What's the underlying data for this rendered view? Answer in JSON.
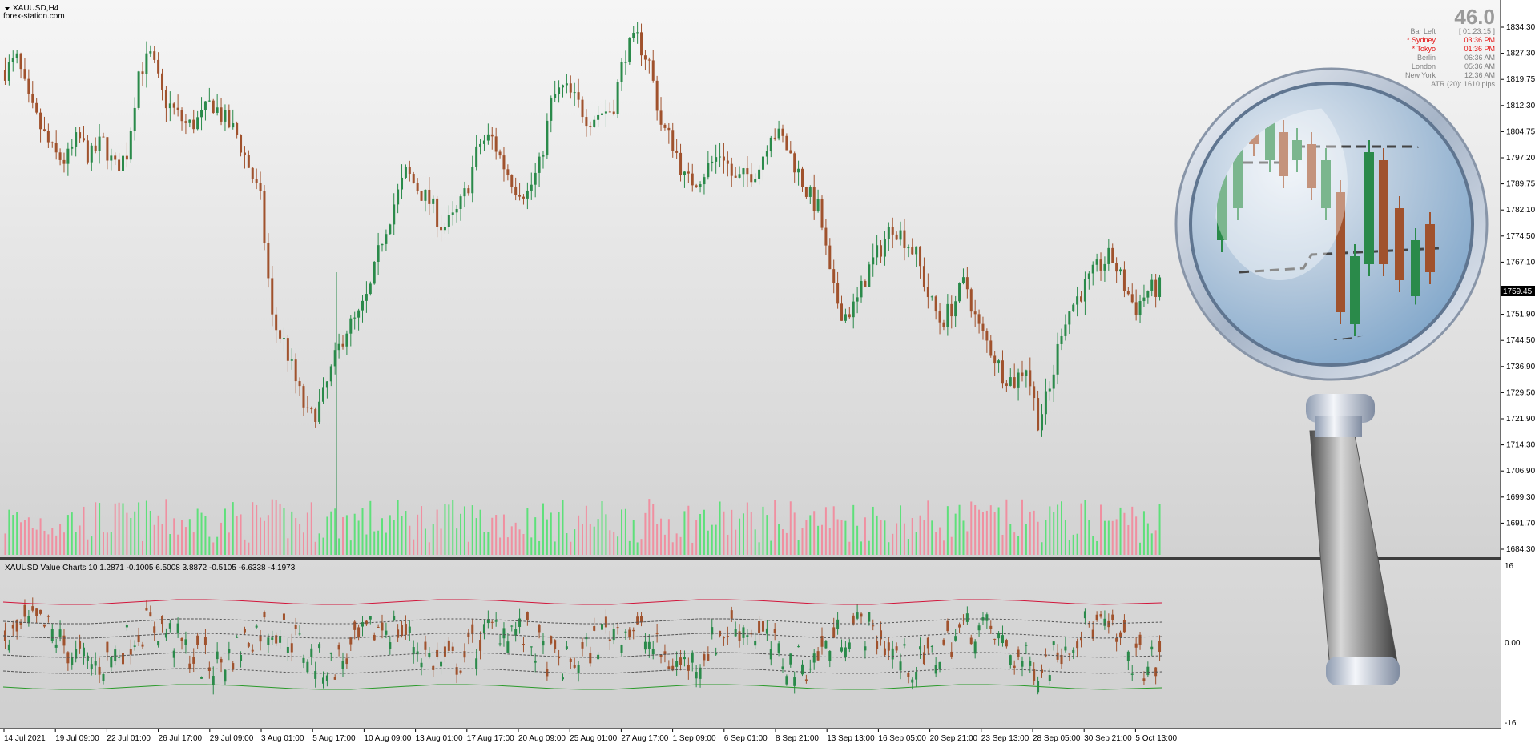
{
  "chart": {
    "symbol_title": "XAUUSD,H4",
    "watermark": "forex-station.com",
    "spread": "46.0",
    "current_price": "1759.45",
    "colors": {
      "bg_top": "#f4f4f4",
      "bg_bottom": "#d4d4d4",
      "bull": "#2a8a4a",
      "bear": "#a0522d",
      "vol_bull": "#5ee07a",
      "vol_bear": "#f08fa0",
      "upper": "#d2143a",
      "lower": "#2a9a2a"
    },
    "price_axis": [
      "1834.30",
      "1827.30",
      "1819.75",
      "1812.30",
      "1804.75",
      "1797.20",
      "1789.75",
      "1782.10",
      "1774.50",
      "1767.10",
      "1751.90",
      "1744.50",
      "1736.90",
      "1729.50",
      "1721.90",
      "1714.30",
      "1706.90",
      "1699.30",
      "1691.70",
      "1684.30"
    ],
    "time_axis": [
      "14 Jul 2021",
      "19 Jul 09:00",
      "22 Jul 01:00",
      "26 Jul 17:00",
      "29 Jul 09:00",
      "3 Aug 01:00",
      "5 Aug 17:00",
      "10 Aug 09:00",
      "13 Aug 01:00",
      "17 Aug 17:00",
      "20 Aug 09:00",
      "25 Aug 01:00",
      "27 Aug 17:00",
      "1 Sep 09:00",
      "6 Sep 01:00",
      "8 Sep 21:00",
      "13 Sep 13:00",
      "16 Sep 05:00",
      "20 Sep 21:00",
      "23 Sep 13:00",
      "28 Sep 05:00",
      "30 Sep 21:00",
      "5 Oct 13:00"
    ]
  },
  "info_panel": {
    "rows": [
      {
        "label": "Bar Left",
        "value": "[ 01:23:15 ]",
        "highlight": false
      },
      {
        "label": "* Sydney",
        "value": "03:36 PM",
        "highlight": true
      },
      {
        "label": "* Tokyo",
        "value": "01:36 PM",
        "highlight": true
      },
      {
        "label": "Berlin",
        "value": "06:36 AM",
        "highlight": false
      },
      {
        "label": "London",
        "value": "05:36 AM",
        "highlight": false
      },
      {
        "label": "New York",
        "value": "12:36 AM",
        "highlight": false
      }
    ],
    "atr": "ATR (20): 1610 pips"
  },
  "subwindow": {
    "title": "XAUUSD Value Charts 10 1.2871 -0.1005 6.5008 3.8872 -0.5105 -6.6338 -4.1973",
    "axis": [
      "16",
      "0.00",
      "-16"
    ]
  },
  "chart_data": {
    "type": "candlestick",
    "series_anchors": [
      1822,
      1825,
      1812,
      1805,
      1798,
      1796,
      1803,
      1797,
      1802,
      1794,
      1798,
      1822,
      1826,
      1814,
      1810,
      1806,
      1808,
      1813,
      1808,
      1804,
      1795,
      1785,
      1750,
      1744,
      1732,
      1722,
      1727,
      1738,
      1748,
      1751,
      1759,
      1774,
      1784,
      1793,
      1788,
      1784,
      1777,
      1780,
      1788,
      1801,
      1803,
      1795,
      1789,
      1787,
      1795,
      1814,
      1817,
      1813,
      1808,
      1810,
      1811,
      1827,
      1831,
      1824,
      1806,
      1801,
      1790,
      1791,
      1795,
      1799,
      1790,
      1792,
      1794,
      1805,
      1802,
      1795,
      1787,
      1782,
      1760,
      1752,
      1755,
      1765,
      1771,
      1778,
      1774,
      1769,
      1757,
      1750,
      1755,
      1762,
      1749,
      1743,
      1736,
      1733,
      1738,
      1722,
      1731,
      1750,
      1756,
      1761,
      1766,
      1769,
      1761,
      1754,
      1759,
      1760
    ],
    "bull_color": "#2a8a4a",
    "bear_color": "#a0522d"
  }
}
